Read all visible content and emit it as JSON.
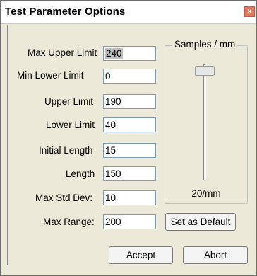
{
  "window": {
    "title": "Test Parameter Options",
    "close_glyph": "×"
  },
  "fields": [
    {
      "label": "Max Upper Limit",
      "value": "240"
    },
    {
      "label": "Min Lower Limit",
      "value": "0"
    },
    {
      "label": "Upper Limit",
      "value": "190"
    },
    {
      "label": "Lower Limit",
      "value": "40"
    },
    {
      "label": "Initial Length",
      "value": "15"
    },
    {
      "label": "Length",
      "value": "150"
    },
    {
      "label": "Max Std Dev:",
      "value": "10"
    },
    {
      "label": "Max Range:",
      "value": "200"
    }
  ],
  "samples": {
    "group_title": "Samples / mm",
    "value_text": "20/mm",
    "level_fraction": 0.05
  },
  "buttons": {
    "set_default": "Set as Default",
    "accept": "Accept",
    "abort": "Abort"
  },
  "colors": {
    "background": "#ece9d8",
    "field_border": "#7f9db9",
    "close_button": "#e07a5f"
  }
}
